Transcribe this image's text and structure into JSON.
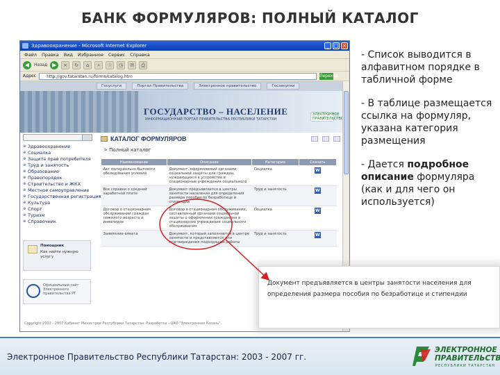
{
  "slide": {
    "title": "БАНК ФОРМУЛЯРОВ: ПОЛНЫЙ КАТАЛОГ",
    "footer_text": "Электронное Правительство Республики Татарстан: 2003 - 2007 гг.",
    "logo_title_line1": "ЭЛЕКТРОННОЕ",
    "logo_title_line2": "ПРАВИТЕЛЬСТВО",
    "logo_subtitle": "РЕСПУБЛИКИ ТАТАРСТАН"
  },
  "notes": [
    {
      "text": "- Список выводится в алфавитном порядке в табличной форме"
    },
    {
      "text": "- В таблице размещается ссылка на формуляр, указана категория размещения"
    },
    {
      "prefix": "- Дается ",
      "bold": "подробное описание",
      "suffix": " формуляра (как и для чего он используется)"
    }
  ],
  "browser": {
    "window_title": "Здравоохранение - Microsoft Internet Explorer",
    "menu": [
      "Файл",
      "Правка",
      "Вид",
      "Избранное",
      "Сервис",
      "Справка"
    ],
    "toolbar": {
      "back_label": "Назад"
    },
    "address_label": "Адрес",
    "address_value": "http://gov.tatarstan.ru/forms/catalog.htm",
    "go_label": "Переход"
  },
  "site": {
    "nav": [
      "Госуслуги",
      "Портал Правительства",
      "Электронное правительство",
      "Госзакупки"
    ],
    "banner_title": "ГОСУДАРСТВО – НАСЕЛЕНИЕ",
    "banner_subtitle": "ИНФОРМАЦИОННЫЙ ПОРТАЛ ПРАВИТЕЛЬСТВА РЕСПУБЛИКИ ТАТАРСТАН",
    "banner_logo": "ЭЛЕКТРОННОЕ ПРАВИТЕЛЬСТВО",
    "menu": [
      "Здравоохранение",
      "Социалка",
      "Защита прав потребителя",
      "Труд и занятость",
      "Образование",
      "Правопорядок",
      "Строительство и ЖКХ",
      "Местное самоуправление",
      "Государственная регистрация",
      "Культура",
      "Спорт",
      "Туризм",
      "Справочник"
    ],
    "help_title": "Помощник",
    "help_text": "Как найти нужную услугу",
    "sponsor_text": "Официальный сайт Электронного правительства РТ",
    "catalog_title": "КАТАЛОГ ФОРМУЛЯРОВ",
    "breadcrumb": "> Полный каталог",
    "table": {
      "headers": [
        "Наименование",
        "Описание",
        "Категория",
        "Скачать"
      ],
      "rows": [
        {
          "name": "Акт материально-бытового обследования условий",
          "desc": "Документ, оформляемый органами социальной защиты для граждан, нуждающихся в устройстве в стационарные учреждения социального",
          "cat": "Социалка",
          "dl": "W"
        },
        {
          "name": "Все справки о средней заработной плате",
          "desc": "Документ предъявляется в центры занятости населения для определения размера пособия по безработице и стипендии",
          "cat": "Труд и занятость",
          "dl": "W"
        },
        {
          "name": "Договор о стационарном обслуживании граждан пожилого возраста и инвалидов",
          "desc": "Договор о стационарном обслуживании, составленный органами социальной защиты о оформлении гражданина в стационарное учреждение социального обслуживания",
          "cat": "Социалка",
          "dl": "W"
        },
        {
          "name": "Заявление-анкета",
          "desc": "Документ, который заполняется в центре занятости и представляется для подтверждения подходящей работы",
          "cat": "Труд и занятость",
          "dl": "W"
        }
      ]
    },
    "copyright": "Copyright 2003 - 2007 Кабинет Министров Республики Татарстан. Разработка - ОАО \"Электронная Казань\"."
  },
  "callout": {
    "text": "Документ предъявляется в центры занятости населения для определения размера пособия по безработице и стипендии"
  }
}
